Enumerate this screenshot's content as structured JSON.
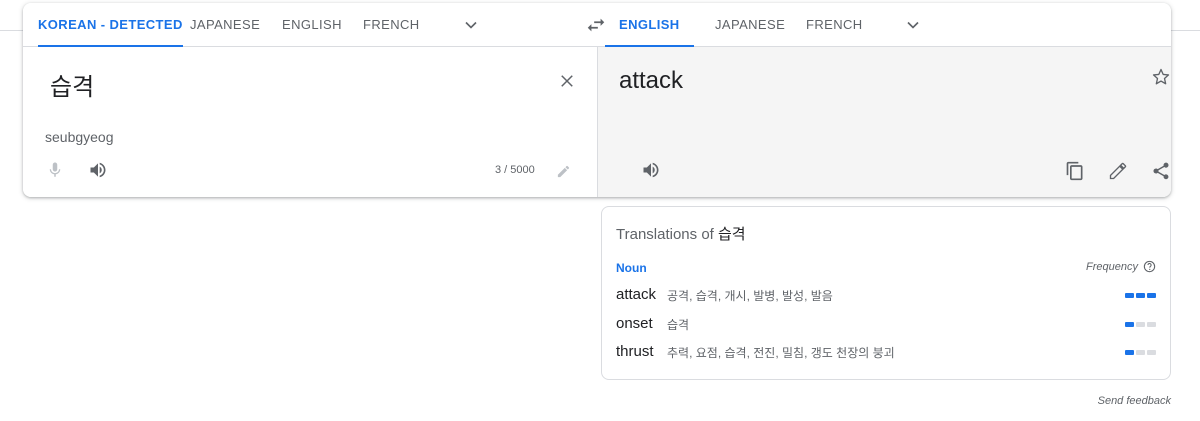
{
  "source_langs": {
    "tabs": [
      "KOREAN - DETECTED",
      "JAPANESE",
      "ENGLISH",
      "FRENCH"
    ],
    "active_index": 0,
    "more_icon": "chevron-down-icon"
  },
  "swap_icon": "swap-icon",
  "target_langs": {
    "tabs": [
      "ENGLISH",
      "JAPANESE",
      "FRENCH"
    ],
    "active_index": 0,
    "more_icon": "chevron-down-icon"
  },
  "source": {
    "text": "습격",
    "romanization": "seubgyeog",
    "char_count": "3 / 5000",
    "icons": [
      "close-icon",
      "microphone-icon",
      "speaker-icon",
      "pencil-icon"
    ]
  },
  "target": {
    "text": "attack",
    "icons": [
      "star-icon",
      "speaker-icon",
      "copy-icon",
      "edit-icon",
      "share-icon"
    ]
  },
  "dictionary": {
    "title_prefix": "Translations of",
    "title_word": "습격",
    "part_of_speech": "Noun",
    "frequency_label": "Frequency",
    "entries": [
      {
        "word": "attack",
        "synonyms": "공격, 습격, 개시, 발병, 발성, 발음",
        "frequency": 3
      },
      {
        "word": "onset",
        "synonyms": "습격",
        "frequency": 1
      },
      {
        "word": "thrust",
        "synonyms": "추력, 요점, 습격, 전진, 밀침, 갱도 천장의 붕괴",
        "frequency": 1
      }
    ]
  },
  "colors": {
    "accent": "#1a73e8",
    "muted": "#5f6368",
    "target_bg": "#f5f5f5"
  },
  "feedback": "Send feedback"
}
